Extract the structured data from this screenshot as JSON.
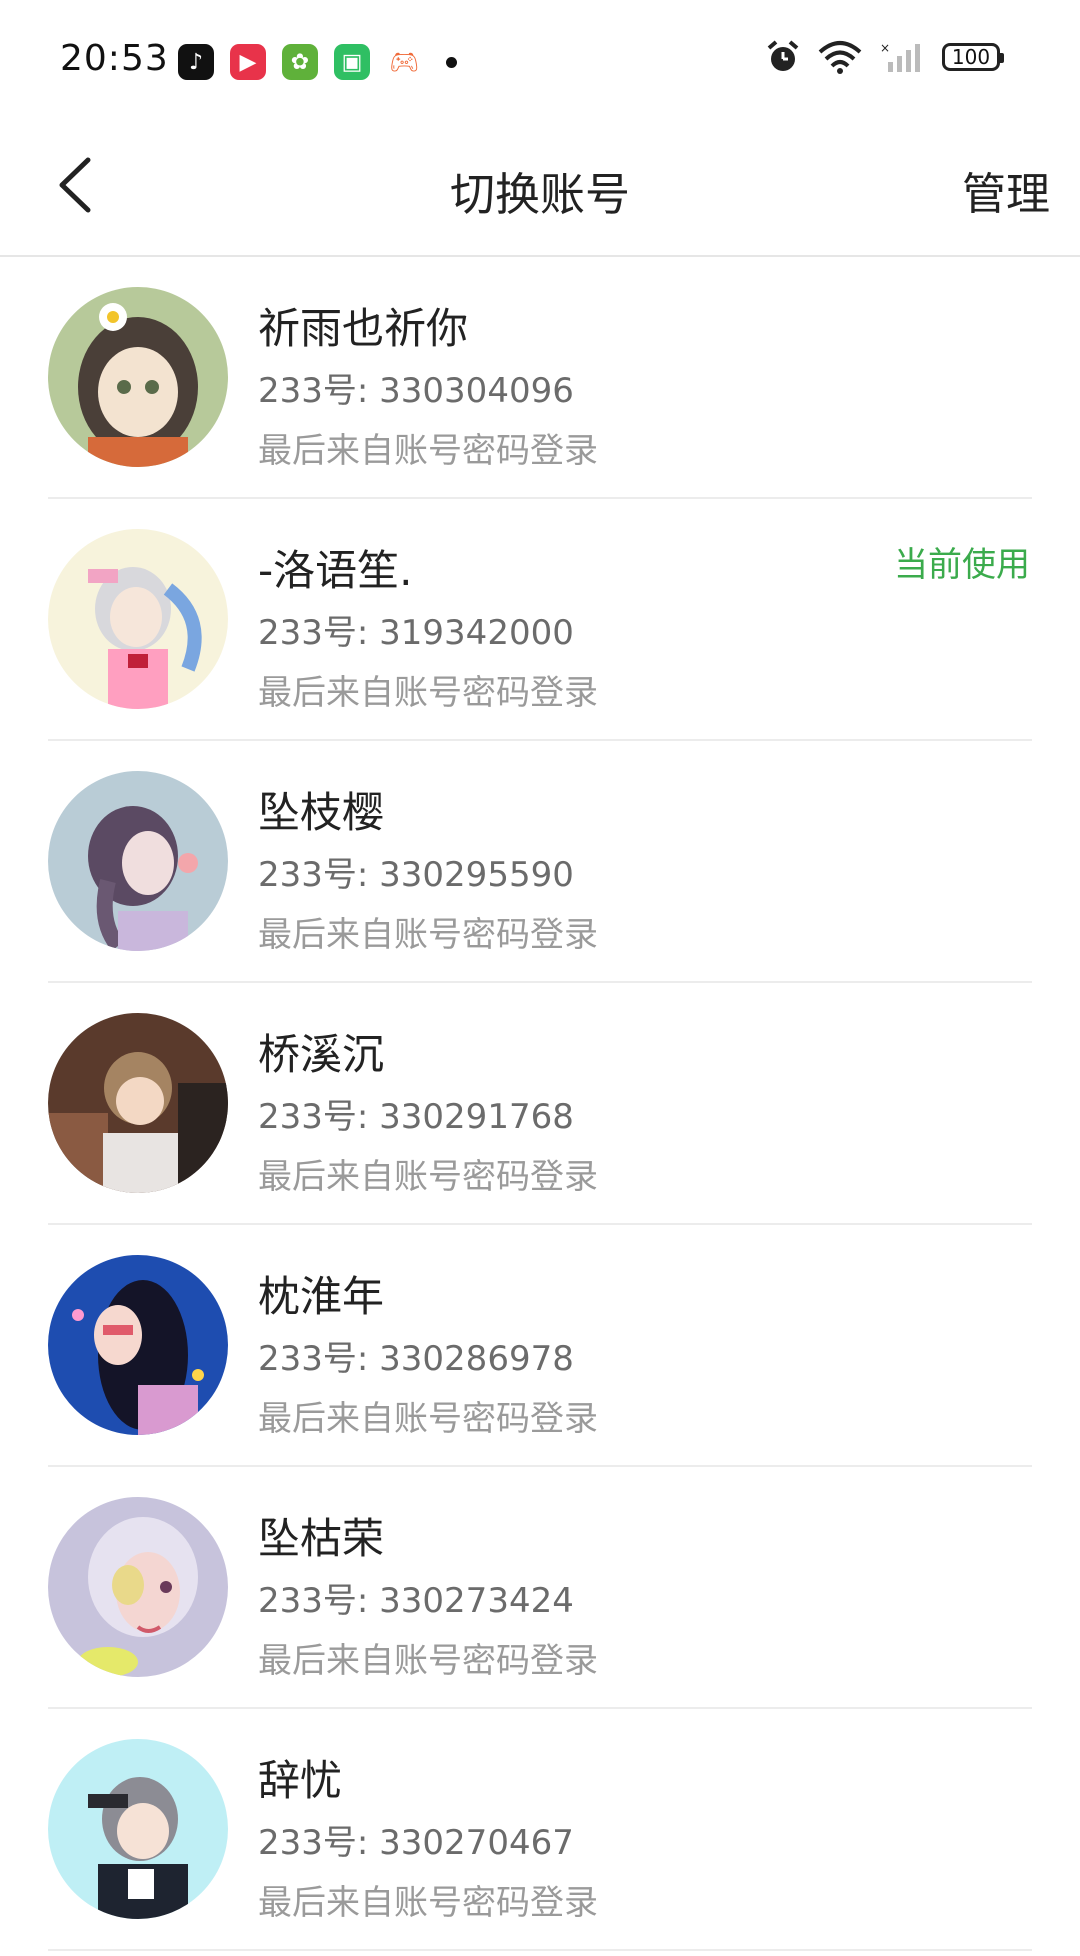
{
  "status_bar": {
    "time": "20:53",
    "battery": "100",
    "app_icons": [
      "tiktok-icon",
      "play-icon",
      "game-icon",
      "app-store-icon",
      "gamepad-icon"
    ]
  },
  "header": {
    "title": "切换账号",
    "manage_label": "管理"
  },
  "accounts": [
    {
      "name": "祈雨也祈你",
      "id": "233号: 330304096",
      "login": "最后来自账号密码登录",
      "current": ""
    },
    {
      "name": "-洛语笙.",
      "id": "233号: 319342000",
      "login": "最后来自账号密码登录",
      "current": "当前使用"
    },
    {
      "name": "坠枝樱",
      "id": "233号: 330295590",
      "login": "最后来自账号密码登录",
      "current": ""
    },
    {
      "name": "桥溪沉",
      "id": "233号: 330291768",
      "login": "最后来自账号密码登录",
      "current": ""
    },
    {
      "name": "枕淮年",
      "id": "233号: 330286978",
      "login": "最后来自账号密码登录",
      "current": ""
    },
    {
      "name": "坠枯荣",
      "id": "233号: 330273424",
      "login": "最后来自账号密码登录",
      "current": ""
    },
    {
      "name": "辞忧",
      "id": "233号: 330270467",
      "login": "最后来自账号密码登录",
      "current": ""
    }
  ],
  "colors": {
    "accent_green": "#3bab4c"
  }
}
